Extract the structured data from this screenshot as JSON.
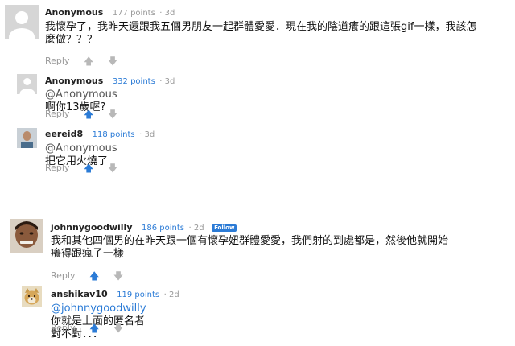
{
  "comments": [
    {
      "username": "Anonymous",
      "points": "177 points",
      "age": "3d",
      "text_line1": "我懷孕了，我昨天還跟我五個男朋友一起群體愛愛．現在我的陰道癢的跟這張gif一樣，我該怎",
      "text_line2": "麼做？？？",
      "reply": "Reply"
    },
    {
      "username": "Anonymous",
      "points": "332 points",
      "age": "3d",
      "mention": "@Anonymous",
      "text": "啊你13歲喔?",
      "reply": "Reply"
    },
    {
      "username": "eereid8",
      "points": "118 points",
      "age": "3d",
      "mention": "@Anonymous",
      "text": "把它用火燒了",
      "reply": "Reply"
    },
    {
      "username": "johnnygoodwilly",
      "points": "186 points",
      "age": "2d",
      "follow": "Follow",
      "text_line1": "我和其他四個男的在昨天跟一個有懷孕妞群體愛愛，我們射的到處都是，然後他就開始",
      "text_line2": "癢得跟瘋子一樣",
      "reply": "Reply"
    },
    {
      "username": "anshikav10",
      "points": "119 points",
      "age": "2d",
      "mention": "@johnnygoodwilly",
      "text": "你就是上面的匿名者對不對．．．",
      "reply": "Reply"
    }
  ],
  "colors": {
    "accent": "#2b7bd6",
    "muted": "#999999"
  },
  "icons": {
    "upvote": "up-arrow-icon",
    "downvote": "down-arrow-icon"
  }
}
